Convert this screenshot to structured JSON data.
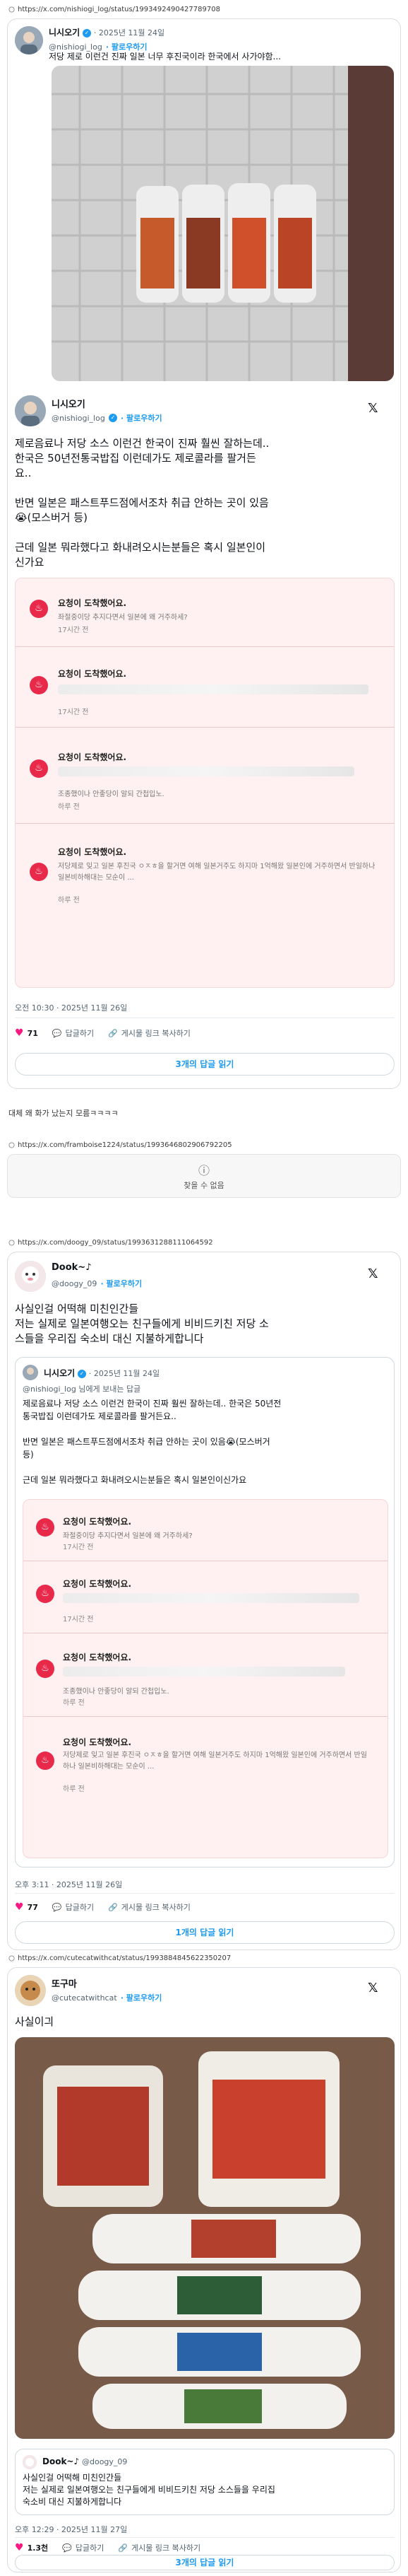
{
  "post1": {
    "url": "https://x.com/nishiogi_log/status/1993492490427789708",
    "header_name": "니시오기",
    "header_date": "· 2025년 11월 24일",
    "header_handle": "@nishiogi_log",
    "header_follow": "· 팔로우하기",
    "header_text": "저당 제로 이런건 진짜 일본 너무 후진국이라 한국에서 사가야함...",
    "name": "니시오기",
    "handle": "@nishiogi_log",
    "follow": "· 팔로우하기",
    "text_lines": [
      "제로음료나 저당 소스 이런건 한국이 진짜 훨씬 잘하는데..",
      "한국은 50년전통국밥집 이런데가도 제로콜라를 팔거든",
      "요..",
      "",
      "반면 일본은 패스트푸드점에서조차 취급 안하는 곳이 있음",
      "😭(모스버거 등)",
      "",
      "근데 일본 뭐라했다고 화내려오시는분들은 혹시 일본인이",
      "신가요"
    ],
    "notifications": [
      {
        "title": "요청이 도착했어요.",
        "sub": "좌절중이당 추지다면서 일본에 왜 거주하세?",
        "time": "17시간 전"
      },
      {
        "title": "요청이 도착했어요.",
        "sub": "",
        "time": "17시간 전"
      },
      {
        "title": "요청이 도착했어요.",
        "sub": "조종했이나 안좋당이 알되 간첩입노.",
        "time": "하루 전"
      },
      {
        "title": "요청이 도착했어요.",
        "sub": "저당제로 잊고 일본 후진국 ㅇㅈㅎ을 할거면 여해 일본거주도 하지마 1억해왔 일본인에 거주하면서 반일하나 일본비하해대는 모순이 ...",
        "time": "하루 전"
      }
    ],
    "timestamp": "오전 10:30 · 2025년 11월 26일",
    "likes": "71",
    "reply_label": "답글하기",
    "copy_label": "게시물 링크 복사하기",
    "replies_btn": "3개의 답글 읽기"
  },
  "reply_text": "대체 왜 화가 났는지 모름ㅋㅋㅋㅋ",
  "post2": {
    "url": "https://x.com/framboise1224/status/1993646802906792205",
    "missing": "찾을 수 없음"
  },
  "post3": {
    "url": "https://x.com/doogy_09/status/1993631288111064592",
    "name": "Dook~♪",
    "handle": "@doogy_09",
    "follow": "· 팔로우하기",
    "text_lines": [
      "사실인걸 어떡해 미친인간들",
      "저는 실제로 일본여행오는 친구들에게 비비드키친 저당 소",
      "스들을 우리집 숙소비 대신 지불하게합니다"
    ],
    "quote_name": "니시오기",
    "quote_date": "· 2025년 11월 24일",
    "quote_handle": "@nishiogi_log 님에게 보내는 답글",
    "quote_lines": [
      "제로음료나 저당 소스 이런건 한국이 진짜 훨씬 잘하는데.. 한국은 50년전",
      "통국밥집 이런데가도 제로콜라를 팔거든요..",
      "",
      "반면 일본은 패스트푸드점에서조차 취급 안하는 곳이 있음😭(모스버거",
      "등)",
      "",
      "근데 일본 뭐라했다고 화내려오시는분들은 혹시 일본인이신가요"
    ],
    "notifications": [
      {
        "title": "요청이 도착했어요.",
        "sub": "좌절중이당 추지다면서 일본에 왜 거주하세?",
        "time": "17시간 전"
      },
      {
        "title": "요청이 도착했어요.",
        "sub": "",
        "time": "17시간 전"
      },
      {
        "title": "요청이 도착했어요.",
        "sub": "조종했이나 안좋당이 알되 간첩입노.",
        "time": "하루 전"
      },
      {
        "title": "요청이 도착했어요.",
        "sub": "저당제로 잊고 일본 후진국 ㅇㅈㅎ을 할거면 여해 일본거주도 하지마 1억해왔 일본인에 거주하면서 반일하나 일본비하해대는 모순이 ...",
        "time": "하루 전"
      }
    ],
    "timestamp": "오후 3:11 · 2025년 11월 26일",
    "likes": "77",
    "reply_label": "답글하기",
    "copy_label": "게시물 링크 복사하기",
    "replies_btn": "1개의 답글 읽기"
  },
  "post4": {
    "url": "https://x.com/cutecatwithcat/status/1993884845622350207",
    "name": "또구마",
    "handle": "@cutecatwithcat",
    "follow": "· 팔로우하기",
    "text": "사실이긔",
    "quote_name": "Dook~♪",
    "quote_handle": "@doogy_09",
    "quote_lines": [
      "사실인걸 어떡해 미친인간들",
      "저는 실제로 일본여행오는 친구들에게 비비드키친 저당 소스들을 우리집",
      "숙소비 대신 지불하게합니다"
    ],
    "timestamp": "오후 12:29 · 2025년 11월 27일",
    "likes": "1.3천",
    "reply_label": "답글하기",
    "copy_label": "게시물 링크 복사하기",
    "replies_btn": "3개의 답글 읽기"
  },
  "colors": {
    "accent": "#1d9bf0",
    "like": "#f91880",
    "notif_bg": "#fff1f1",
    "notif_icon": "#e8294a"
  }
}
